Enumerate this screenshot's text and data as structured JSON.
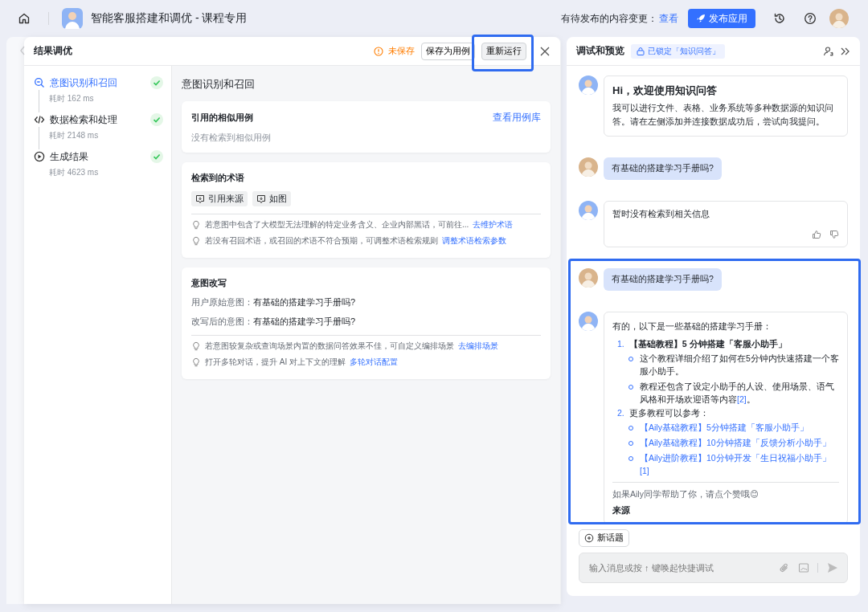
{
  "topbar": {
    "title": "智能客服搭建和调优 - 课程专用",
    "pending_label": "有待发布的内容变更：",
    "pending_link": "查看",
    "publish_button": "发布应用"
  },
  "tuning_panel": {
    "title": "结果调优",
    "unsaved": "未保存",
    "save_case_button": "保存为用例",
    "rerun_button": "重新运行",
    "steps": [
      {
        "kind": "intent",
        "label": "意图识别和召回",
        "time": "耗时 162 ms",
        "done": true,
        "selected": true
      },
      {
        "kind": "code",
        "label": "数据检索和处理",
        "time": "耗时 2148 ms",
        "done": true,
        "selected": false
      },
      {
        "kind": "result",
        "label": "生成结果",
        "time": "耗时 4623 ms",
        "done": true,
        "selected": false
      }
    ],
    "section_title": "意图识别和召回",
    "similar_cases": {
      "title": "引用的相似用例",
      "link": "查看用例库",
      "empty": "没有检索到相似用例"
    },
    "terms": {
      "title": "检索到的术语",
      "tags": [
        "引用来源",
        "如图"
      ],
      "tips": [
        {
          "text": "若意图中包含了大模型无法理解的特定业务含义、企业内部黑话，可前往...",
          "link": "去维护术语"
        },
        {
          "text": "若没有召回术语，或召回的术语不符合预期，可调整术语检索规则",
          "link": "调整术语检索参数"
        }
      ]
    },
    "rewrite": {
      "title": "意图改写",
      "rows": [
        {
          "label": "用户原始意图：",
          "value": "有基础的搭建学习手册吗?"
        },
        {
          "label": "改写后的意图：",
          "value": "有基础的搭建学习手册吗?"
        }
      ],
      "tips": [
        {
          "text": "若意图较复杂或查询场景内置的数据问答效果不佳，可自定义编排场景",
          "link": "去编排场景"
        },
        {
          "text": "打开多轮对话，提升 AI 对上下文的理解",
          "link": "多轮对话配置"
        }
      ]
    }
  },
  "preview": {
    "title": "调试和预览",
    "lock_badge": "已锁定「知识问答」",
    "messages": [
      {
        "kind": "welcome",
        "title": "Hi，欢迎使用知识问答",
        "text": "我可以进行文件、表格、业务系统等多种数据源的知识问答。请在左侧添加并连接数据成功后，尝试向我提问。"
      },
      {
        "kind": "user",
        "text": "有基础的搭建学习手册吗?"
      },
      {
        "kind": "reply",
        "text": "暂时没有检索到相关信息"
      },
      {
        "kind": "user",
        "text": "有基础的搭建学习手册吗?"
      },
      {
        "kind": "answer",
        "intro": "有的，以下是一些基础的搭建学习手册：",
        "items": [
          {
            "number": "1.",
            "text": "【基础教程】5 分钟搭建「客服小助手」",
            "subs": [
              {
                "kind": "text",
                "text": "这个教程详细介绍了如何在5分钟内快速搭建一个客服小助手。"
              },
              {
                "kind": "text",
                "text": "教程还包含了设定小助手的人设、使用场景、语气风格和开场欢迎语等内容",
                "ref": "[2]",
                "tail": "。"
              }
            ]
          },
          {
            "number": "2.",
            "text": "更多教程可以参考：",
            "subs": [
              {
                "kind": "link",
                "text": "【Aily基础教程】5分钟搭建「客服小助手」"
              },
              {
                "kind": "link",
                "text": "【Aily基础教程】10分钟搭建「反馈分析小助手」"
              },
              {
                "kind": "link",
                "text": "【Aily进阶教程】10分钟开发「生日祝福小助手」[1]"
              }
            ]
          }
        ],
        "footer": "如果Aily同学帮助了你，请点个赞哦😊",
        "sources_title": "来源"
      }
    ],
    "new_topic_button": "新话题",
    "input": {
      "placeholder": "输入消息或按 ↑ 键唤起快捷调试"
    }
  }
}
